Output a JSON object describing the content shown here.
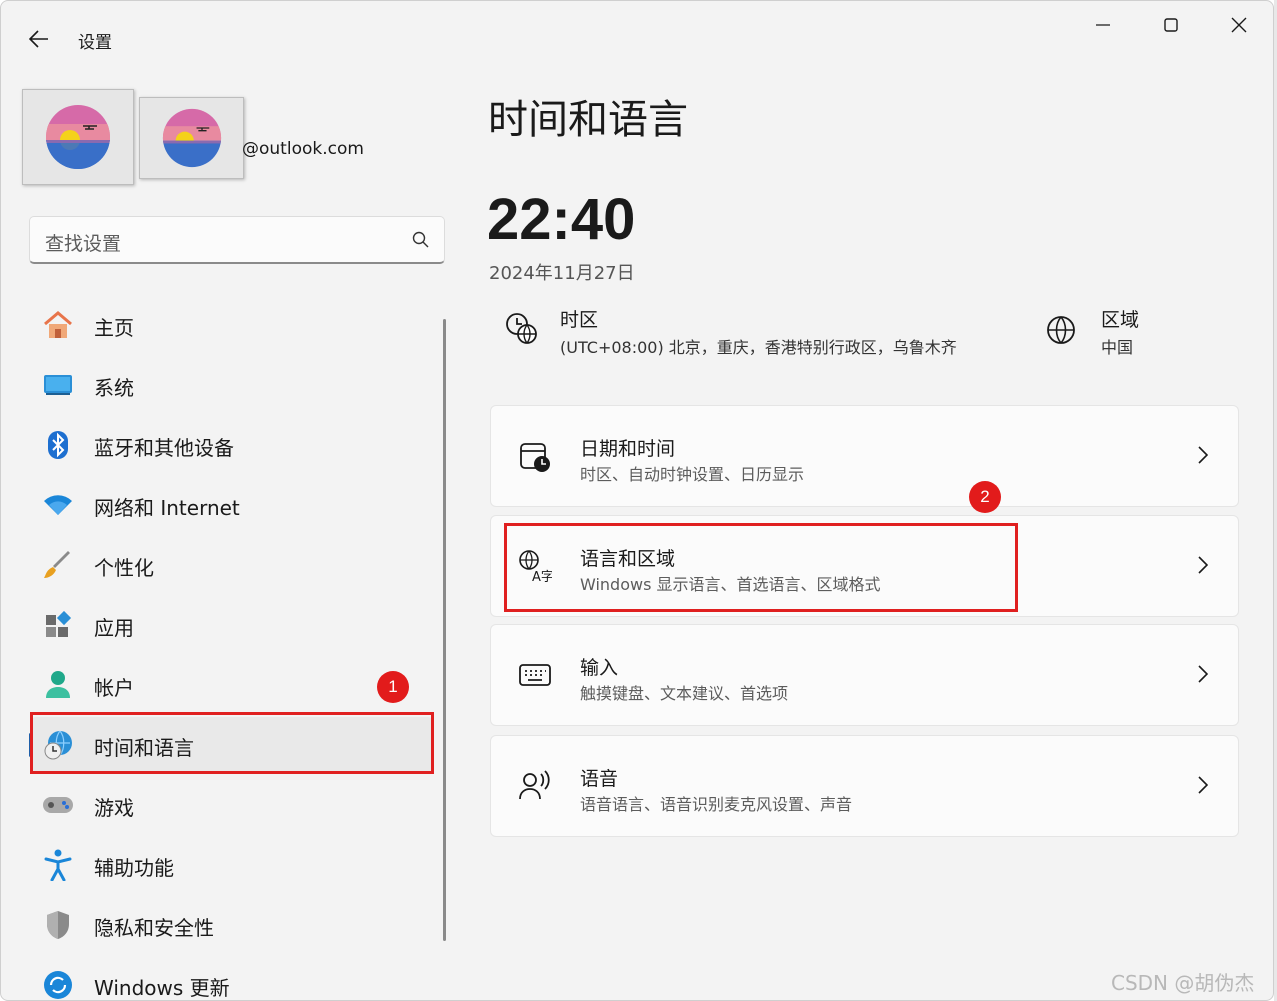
{
  "window": {
    "title": "设置"
  },
  "profile": {
    "email": "@outlook.com"
  },
  "search": {
    "placeholder": "查找设置"
  },
  "nav": {
    "items": [
      {
        "label": "主页",
        "icon": "home-icon"
      },
      {
        "label": "系统",
        "icon": "display-icon"
      },
      {
        "label": "蓝牙和其他设备",
        "icon": "bluetooth-icon"
      },
      {
        "label": "网络和 Internet",
        "icon": "wifi-icon"
      },
      {
        "label": "个性化",
        "icon": "paintbrush-icon"
      },
      {
        "label": "应用",
        "icon": "apps-icon"
      },
      {
        "label": "帐户",
        "icon": "person-icon"
      },
      {
        "label": "时间和语言",
        "icon": "globe-clock-icon",
        "selected": true
      },
      {
        "label": "游戏",
        "icon": "gamepad-icon"
      },
      {
        "label": "辅助功能",
        "icon": "accessibility-icon"
      },
      {
        "label": "隐私和安全性",
        "icon": "shield-icon"
      },
      {
        "label": "Windows 更新",
        "icon": "update-icon"
      }
    ]
  },
  "annotations": {
    "badge_1": "1",
    "badge_2": "2"
  },
  "main": {
    "title": "时间和语言",
    "clock": "22:40",
    "date": "2024年11月27日",
    "timezone": {
      "title": "时区",
      "value": "(UTC+08:00) 北京，重庆，香港特别行政区，乌鲁木齐"
    },
    "region": {
      "title": "区域",
      "value": "中国"
    },
    "cards": [
      {
        "title": "日期和时间",
        "desc": "时区、自动时钟设置、日历显示",
        "icon": "calendar-clock-icon"
      },
      {
        "title": "语言和区域",
        "desc": "Windows 显示语言、首选语言、区域格式",
        "icon": "language-icon"
      },
      {
        "title": "输入",
        "desc": "触摸键盘、文本建议、首选项",
        "icon": "keyboard-icon"
      },
      {
        "title": "语音",
        "desc": "语音语言、语音识别麦克风设置、声音",
        "icon": "speech-icon"
      }
    ]
  },
  "watermark": "CSDN @胡伪杰",
  "colors": {
    "accent": "#1f5fa8",
    "annotation_red": "#e02020"
  }
}
